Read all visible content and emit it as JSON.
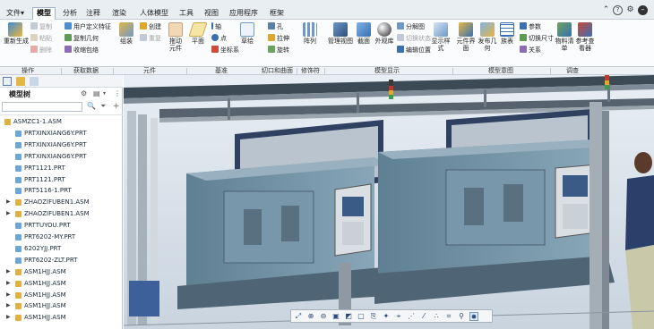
{
  "menu": {
    "file": "文件",
    "tabs": [
      "模型",
      "分析",
      "注释",
      "渲染",
      "人体模型",
      "工具",
      "视图",
      "应用程序",
      "框架"
    ],
    "active_tab": "模型"
  },
  "window": {
    "help": "?",
    "settings": "⚙",
    "minimize": "–"
  },
  "ribbon": {
    "regen": "重新生成",
    "copy": "复制",
    "paste": "粘贴",
    "delete": "删除",
    "user_feature": "用户定义特征",
    "copy_geometry": "复制几何",
    "shrinkwrap": "收缩包络",
    "assemble": "组装",
    "create": "创建",
    "repeat": "重复",
    "drag_components": "拖动元件",
    "plane": "平面",
    "axis": "轴",
    "point": "点",
    "csys": "坐标系",
    "sketch": "草绘",
    "hole": "孔",
    "extrude": "拉伸",
    "revolve": "旋转",
    "pattern": "阵列",
    "manage_views": "管理视图",
    "section": "截面",
    "appearance": "外观库",
    "explode_view": "分解图",
    "toggle_status": "切换状态",
    "edit_position": "编辑位置",
    "show_style": "显示样式",
    "component_interface": "元件界面",
    "publish_geometry": "发布几何",
    "family_table": "族表",
    "parameters": "参数",
    "switch_dimensions": "切换尺寸",
    "relations": "关系",
    "bom": "物料清单",
    "reference_viewer": "参考查看器"
  },
  "groups": {
    "operations": "操作",
    "get_data": "获取数据",
    "components": "元件",
    "datum": "基准",
    "cut_surface": "切口和曲面",
    "modifiers": "修饰符",
    "model_display": "模型显示",
    "model_intent": "模型意图",
    "investigate": "调查"
  },
  "panel": {
    "title": "模型树",
    "search_icon_label": "🔍"
  },
  "tree": [
    {
      "label": "ASMZC1-1.ASM",
      "kind": "asm",
      "expand": ""
    },
    {
      "label": "PRTXINXIANG6Y.PRT",
      "kind": "prt",
      "expand": ""
    },
    {
      "label": "PRTXINXIANG6Y.PRT",
      "kind": "prt",
      "expand": ""
    },
    {
      "label": "PRTXINXIANG6Y.PRT",
      "kind": "prt",
      "expand": ""
    },
    {
      "label": "PRT1121.PRT",
      "kind": "prt",
      "expand": ""
    },
    {
      "label": "PRT1121.PRT",
      "kind": "prt",
      "expand": ""
    },
    {
      "label": "PRT5116-1.PRT",
      "kind": "prt",
      "expand": ""
    },
    {
      "label": "ZHAOZIFUBEN1.ASM",
      "kind": "asm",
      "expand": "▶"
    },
    {
      "label": "ZHAOZIFUBEN1.ASM",
      "kind": "asm",
      "expand": "▶"
    },
    {
      "label": "PRTTUYOU.PRT",
      "kind": "prt",
      "expand": ""
    },
    {
      "label": "PRT6202-MY.PRT",
      "kind": "prt",
      "expand": ""
    },
    {
      "label": "6202YJJ.PRT",
      "kind": "prt",
      "expand": ""
    },
    {
      "label": "PRT6202-ZLT.PRT",
      "kind": "prt",
      "expand": ""
    },
    {
      "label": "ASM1HJJ.ASM",
      "kind": "asm",
      "expand": "▶"
    },
    {
      "label": "ASM1HJJ.ASM",
      "kind": "asm",
      "expand": "▶"
    },
    {
      "label": "ASM1HJJ.ASM",
      "kind": "asm",
      "expand": "▶"
    },
    {
      "label": "ASM1HJJ.ASM",
      "kind": "asm",
      "expand": "▶"
    },
    {
      "label": "ASM1HJJ.ASM",
      "kind": "asm",
      "expand": "▶"
    }
  ],
  "colors": {
    "accent": "#2b6cb0",
    "tab_bar": "#e9eef3",
    "part_icon": "#6aa7d8",
    "asm_icon": "#e2b040",
    "machine": "#6f8fa3",
    "frame": "#9aa4ae"
  }
}
